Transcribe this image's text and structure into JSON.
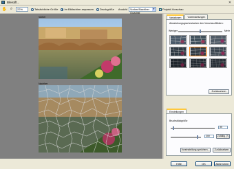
{
  "window": {
    "title": "Bleistift..."
  },
  "toolbar": {
    "zoom": "22%",
    "actual_size": "Tatsächliche Größe",
    "fit": "Im Bildschirm anpassen",
    "print_size": "Druckgröße",
    "view_label": "Ansicht",
    "view_value": "Vorher/Nachher Quadrat",
    "project_preview": "Projekt-Vorschau"
  },
  "preview": {
    "before_label": "Vorher",
    "after_label": "Nachher"
  },
  "panel": {
    "tabs": [
      "Variationen",
      "Voreinstellungen"
    ],
    "variation_title": "Abweichungsgrad zwischen den Vorschau-Bildern:",
    "less": "Weniger",
    "more": "Mehr",
    "reset_button": "Zurücksetzen",
    "settings_tab": "Einstellungen",
    "param_label": "Bruchstückgröße",
    "param_value_1": "30",
    "param_value_2": "200",
    "random_button": "Zufällig (?)",
    "save_preset": "Voreinstellung speichern...",
    "reset_button_2": "Zurücksetzen"
  },
  "footer": {
    "help": "Hilfe",
    "ok": "OK",
    "cancel": "Abbrechen"
  },
  "colors": {
    "accent_tab": "#ffc83c",
    "selected_thumb": "#ff8c1a",
    "canvas": "#808080"
  }
}
